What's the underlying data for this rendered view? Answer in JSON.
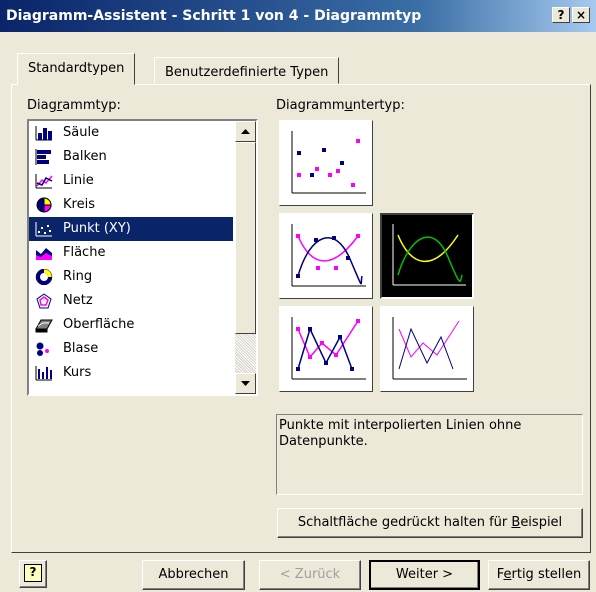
{
  "window": {
    "title": "Diagramm-Assistent - Schritt 1 von 4 - Diagrammtyp",
    "help_button": "?",
    "close_button": "×"
  },
  "tabs": [
    {
      "label": "Standardtypen",
      "active": true
    },
    {
      "label": "Benutzerdefinierte Typen",
      "active": false
    }
  ],
  "chart_type": {
    "label_pre": "Diag",
    "label_mnemonic": "r",
    "label_post": "ammtyp:",
    "items": [
      {
        "label": "Säule",
        "icon": "column-chart-icon"
      },
      {
        "label": "Balken",
        "icon": "bar-chart-icon"
      },
      {
        "label": "Linie",
        "icon": "line-chart-icon"
      },
      {
        "label": "Kreis",
        "icon": "pie-chart-icon"
      },
      {
        "label": "Punkt (XY)",
        "icon": "scatter-chart-icon",
        "selected": true
      },
      {
        "label": "Fläche",
        "icon": "area-chart-icon"
      },
      {
        "label": "Ring",
        "icon": "doughnut-chart-icon"
      },
      {
        "label": "Netz",
        "icon": "radar-chart-icon"
      },
      {
        "label": "Oberfläche",
        "icon": "surface-chart-icon"
      },
      {
        "label": "Blase",
        "icon": "bubble-chart-icon"
      },
      {
        "label": "Kurs",
        "icon": "stock-chart-icon"
      }
    ]
  },
  "subtype": {
    "label_pre": "Diagramm",
    "label_mnemonic": "u",
    "label_post": "ntertyp:",
    "selected_index": 2,
    "colors": {
      "magenta": "#ff00ff",
      "navy": "#000080",
      "yellow": "#ffff00",
      "green": "#00c000"
    },
    "description": "Punkte mit interpolierten Linien ohne Datenpunkte."
  },
  "preview_button": {
    "pre": "Schaltfläche gedrückt halten für ",
    "mnemonic": "B",
    "post": "eispiel"
  },
  "footer": {
    "help_icon": "?",
    "cancel": "Abbrechen",
    "back": "< Zurück",
    "next": "Weiter >",
    "finish_pre": "F",
    "finish_mnemonic": "e",
    "finish_post": "rtig stellen"
  }
}
